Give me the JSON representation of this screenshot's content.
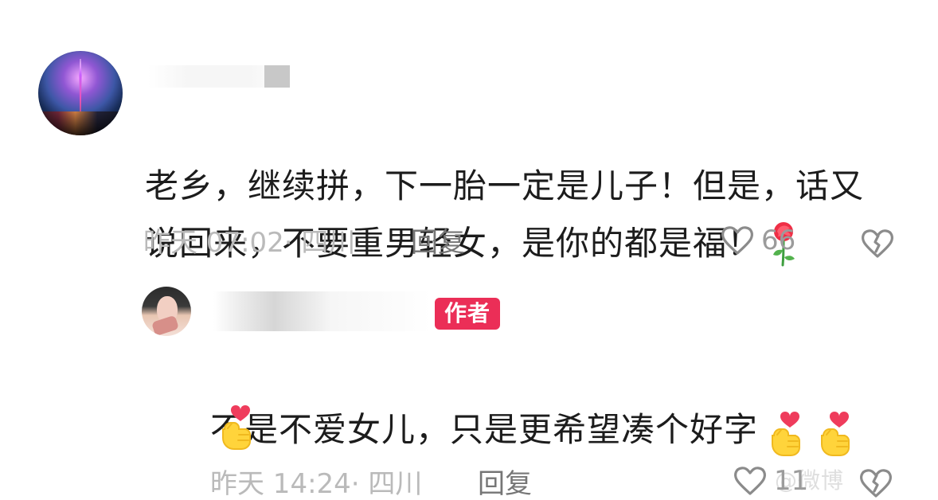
{
  "comments": {
    "main": {
      "text": "老乡，继续拼，下一胎一定是儿子！但是，话又\n说回来，不要重男轻女，是你的都是福！",
      "time_location": "昨天 07:02· 四川",
      "reply_label": "回复",
      "likes": "66"
    },
    "reply": {
      "author_badge": "作者",
      "text": "不是不爱女儿，只是更希望凑个好字",
      "time_location": "昨天 14:24· 四川",
      "reply_label": "回复",
      "likes": "11"
    }
  },
  "watermark": "@微博"
}
